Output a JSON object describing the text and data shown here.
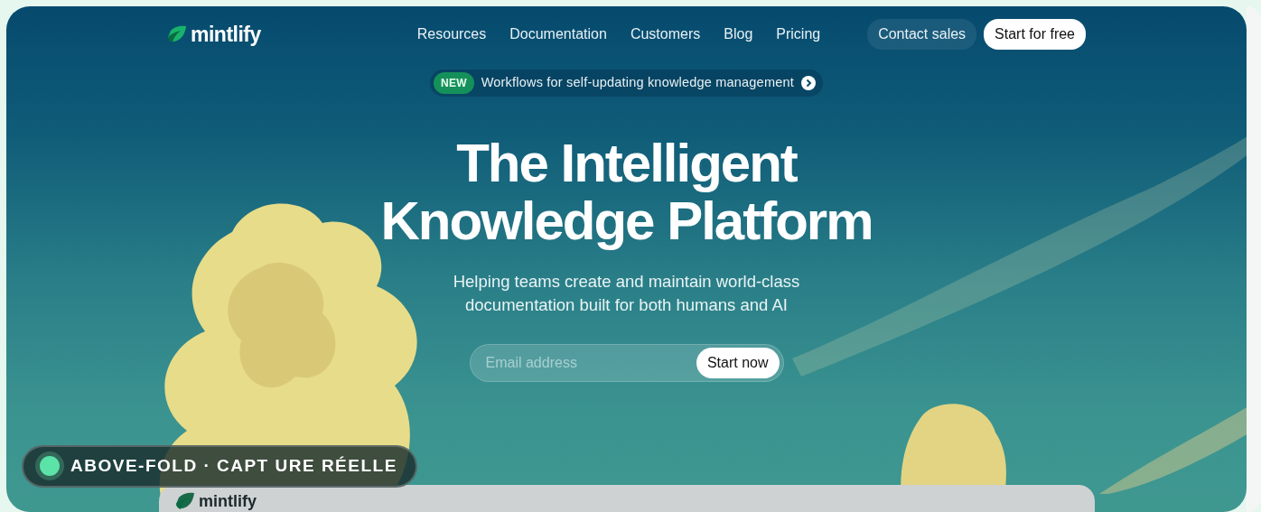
{
  "nav": {
    "logo": "mintlify",
    "links": [
      "Resources",
      "Documentation",
      "Customers",
      "Blog",
      "Pricing"
    ],
    "buttons": [
      {
        "label": "Contact sales",
        "kind": "secondary"
      },
      {
        "label": "Start for free",
        "kind": "primary"
      }
    ]
  },
  "announcement": {
    "badge": "NEW",
    "text": "Workflows for self-updating knowledge management"
  },
  "hero": {
    "title_lines": [
      "The Intelligent",
      "Knowledge Platform"
    ],
    "subtitle_lines": [
      "Helping teams create and maintain world-class",
      "documentation built for both humans and AI"
    ]
  },
  "signup": {
    "placeholder": "Email address",
    "button": "Start now"
  },
  "capture_badge": {
    "text": "ABOVE-FOLD · CAPT URE RÉELLE"
  },
  "preview": {
    "logo": "mintlify"
  }
}
